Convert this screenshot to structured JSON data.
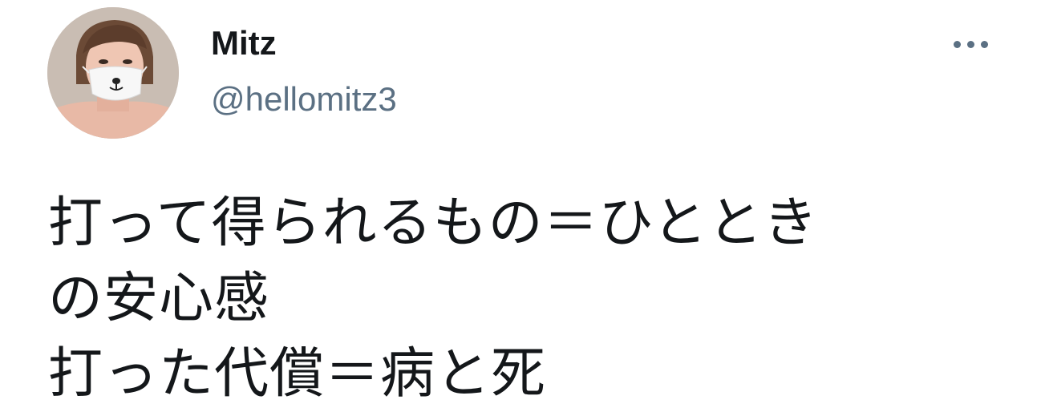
{
  "author": {
    "name": "Mitz",
    "handle": "@hellomitz3"
  },
  "tweet": {
    "lines": [
      "打って得られるもの＝ひとときの安心感",
      "打った代償＝病と死"
    ],
    "wrapped_lines": [
      "打って得られるもの＝ひととき",
      "の安心感",
      "打った代償＝病と死"
    ]
  },
  "icons": {
    "more": "more-horizontal-icon"
  },
  "colors": {
    "name_text": "#14171a",
    "handle_text": "#5b7083",
    "body_text": "#14171a",
    "background": "#ffffff"
  }
}
